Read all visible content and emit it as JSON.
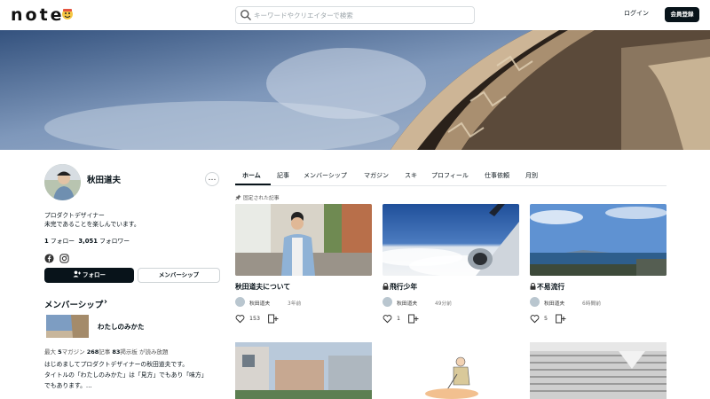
{
  "header": {
    "logo": "note",
    "search_placeholder": "キーワードやクリエイターで検索",
    "login_label": "ログイン",
    "signup_label": "会員登録"
  },
  "profile": {
    "name": "秋田道夫",
    "more_label": "…",
    "bio_line1": "プロダクトデザイナー",
    "bio_line2": "未完であることを楽しんでいます。",
    "following_count": "1",
    "following_label": "フォロー",
    "follower_count": "3,051",
    "follower_label": "フォロワー",
    "follow_button": "フォロー",
    "membership_button": "メンバーシップ"
  },
  "membership": {
    "title": "メンバーシップ",
    "chevron": "›",
    "magazine_name": "わたしのみかた",
    "stats": {
      "prefix": "最大 ",
      "magazines_count": "5",
      "magazines_label": "マガジン ",
      "articles_count": "268",
      "articles_label": "記事 ",
      "boards_count": "83",
      "boards_label": "掲示板",
      "suffix": " が読み放題"
    },
    "desc_line1": "はじめましてプロダクトデザイナーの秋田道夫です。",
    "desc_line2": "タイトルの「わたしのみかた」は「見方」でもあり「味方」",
    "desc_line3": "でもあります。…"
  },
  "tabs": [
    "ホーム",
    "記事",
    "メンバーシップ",
    "マガジン",
    "スキ",
    "プロフィール",
    "仕事依頼",
    "月別"
  ],
  "pinned_label": "固定された記事",
  "cards": [
    {
      "title": "秋田道夫について",
      "locked": false,
      "author": "秋田道夫",
      "time": "3年前",
      "likes": "153"
    },
    {
      "title": "飛行少年",
      "locked": true,
      "author": "秋田道夫",
      "time": "49分前",
      "likes": "1"
    },
    {
      "title": "不易流行",
      "locked": true,
      "author": "秋田道夫",
      "time": "6時間前",
      "likes": "5"
    }
  ],
  "colors": {
    "primary": "#08131a",
    "border": "#cfd4d7"
  }
}
